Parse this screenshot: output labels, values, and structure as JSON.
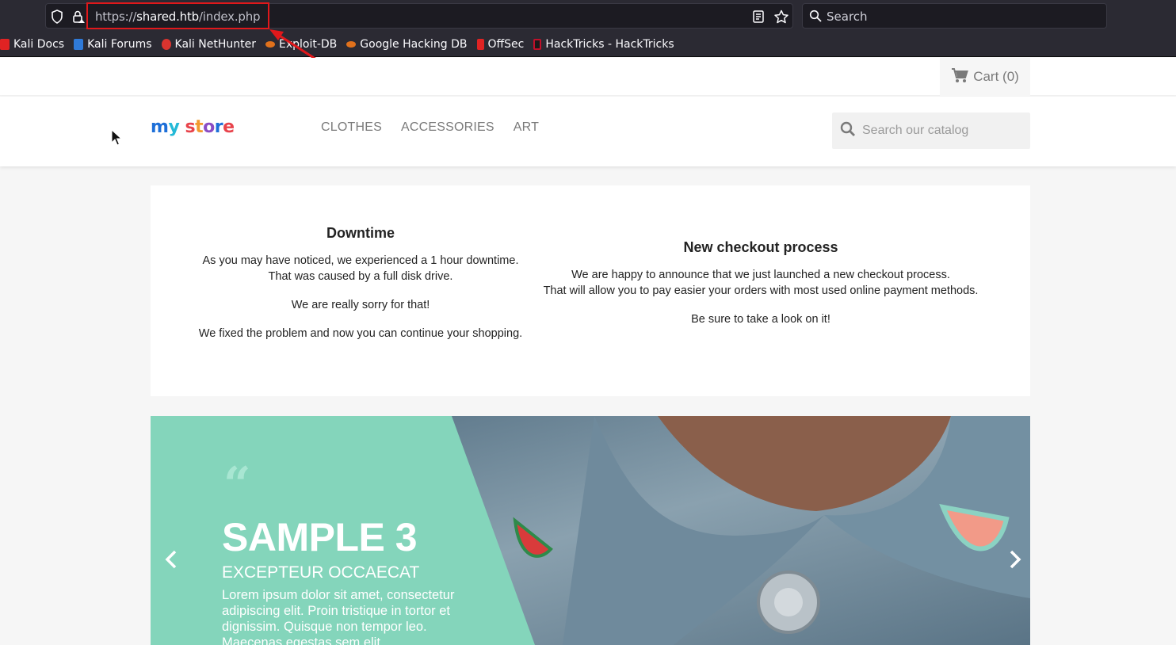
{
  "browser": {
    "url_base": "https://",
    "url_host": "shared.htb",
    "url_path": "/index.php",
    "search_placeholder": "Search",
    "bookmarks": [
      {
        "label": "Kali Docs",
        "icon": "kali-icon",
        "color": "#e02323"
      },
      {
        "label": "Kali Forums",
        "icon": "kali-icon",
        "color": "#2f7ad9"
      },
      {
        "label": "Kali NetHunter",
        "icon": "kali-icon",
        "color": "#d9342f"
      },
      {
        "label": "Exploit-DB",
        "icon": "exploitdb-icon",
        "color": "#e0711c"
      },
      {
        "label": "Google Hacking DB",
        "icon": "exploitdb-icon",
        "color": "#e0711c"
      },
      {
        "label": "OffSec",
        "icon": "offsec-icon",
        "color": "#e02323"
      },
      {
        "label": "HackTricks - HackTricks",
        "icon": "hacktricks-icon",
        "color": "#c0102a"
      }
    ]
  },
  "store": {
    "cart_label": "Cart (0)",
    "logo": {
      "part1a": "m",
      "part1b": "y",
      "part2": [
        "s",
        "t",
        "o",
        "r",
        "e"
      ]
    },
    "nav": [
      "CLOTHES",
      "ACCESSORIES",
      "ART"
    ],
    "search_placeholder": "Search our catalog"
  },
  "notices": {
    "downtime": {
      "title": "Downtime",
      "p1_line1": "As you may have noticed, we experienced a 1 hour downtime.",
      "p1_line2": "That was caused by a full disk drive.",
      "p2": "We are really sorry for that!",
      "p3": "We fixed the problem and now you can continue your shopping."
    },
    "checkout": {
      "title": "New checkout process",
      "p1_line1": "We are happy to announce that we just launched a new checkout process.",
      "p1_line2": "That will allow you to pay easier your orders with most used online payment methods.",
      "p2": "Be sure to take a look on it!"
    }
  },
  "slider": {
    "quote_mark": "“",
    "title": "SAMPLE 3",
    "subtitle": "EXCEPTEUR OCCAECAT",
    "description": "Lorem ipsum dolor sit amet, consectetur adipiscing elit. Proin tristique in tortor et dignissim. Quisque non tempor leo. Maecenas egestas sem elit",
    "accent_color": "#84d5bb"
  },
  "annotation_color": "#e0181b"
}
